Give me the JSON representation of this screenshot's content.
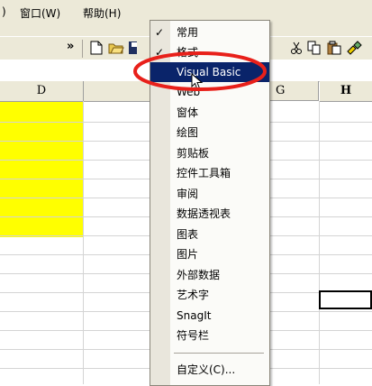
{
  "menubar": {
    "items": [
      {
        "label": ")"
      },
      {
        "label": "窗口(W)"
      },
      {
        "label": "帮助(H)"
      }
    ]
  },
  "toolbar": {
    "chevron": "»",
    "icons": [
      "new-document-icon",
      "open-folder-icon",
      "save-icon",
      "cut-icon",
      "copy-icon",
      "paste-icon",
      "format-painter-icon"
    ]
  },
  "columns": [
    "D",
    "E",
    "G",
    "H"
  ],
  "dropdown": {
    "items": [
      {
        "label": "常用",
        "checked": true
      },
      {
        "label": "格式",
        "checked": true
      },
      {
        "label": "Visual Basic",
        "highlighted": true
      },
      {
        "label": "Web"
      },
      {
        "label": "窗体"
      },
      {
        "label": "绘图"
      },
      {
        "label": "剪贴板"
      },
      {
        "label": "控件工具箱"
      },
      {
        "label": "审阅"
      },
      {
        "label": "数据透视表"
      },
      {
        "label": "图表"
      },
      {
        "label": "图片"
      },
      {
        "label": "外部数据"
      },
      {
        "label": "艺术字"
      },
      {
        "label": "SnagIt"
      },
      {
        "label": "符号栏"
      }
    ],
    "customize": "自定义(C)..."
  },
  "colors": {
    "highlight": "#0a246a",
    "annotation": "#e8201a",
    "fill": "#ffff00"
  }
}
